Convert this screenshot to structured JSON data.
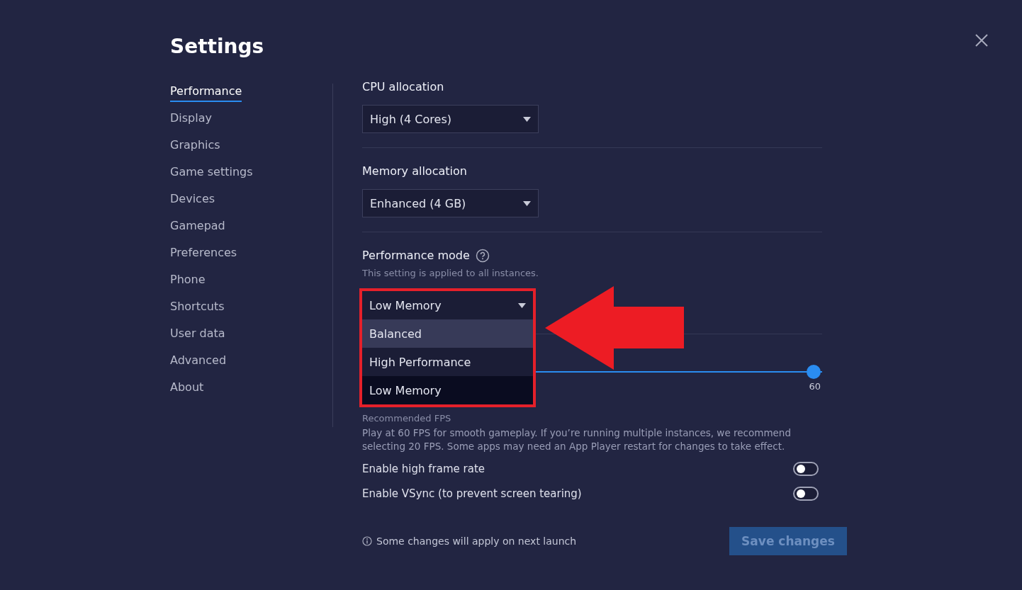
{
  "title": "Settings",
  "sidebar": {
    "items": [
      {
        "label": "Performance",
        "selected": true
      },
      {
        "label": "Display",
        "selected": false
      },
      {
        "label": "Graphics",
        "selected": false
      },
      {
        "label": "Game settings",
        "selected": false
      },
      {
        "label": "Devices",
        "selected": false
      },
      {
        "label": "Gamepad",
        "selected": false
      },
      {
        "label": "Preferences",
        "selected": false
      },
      {
        "label": "Phone",
        "selected": false
      },
      {
        "label": "Shortcuts",
        "selected": false
      },
      {
        "label": "User data",
        "selected": false
      },
      {
        "label": "Advanced",
        "selected": false
      },
      {
        "label": "About",
        "selected": false
      }
    ]
  },
  "cpu": {
    "label": "CPU allocation",
    "value": "High (4 Cores)"
  },
  "memory": {
    "label": "Memory allocation",
    "value": "Enhanced (4 GB)"
  },
  "performance_mode": {
    "label": "Performance mode",
    "hint": "This setting is applied to all instances.",
    "value": "Low Memory",
    "expanded": true,
    "options": [
      {
        "label": "Balanced",
        "highlighted": true,
        "selected": false
      },
      {
        "label": "High Performance",
        "highlighted": false,
        "selected": false
      },
      {
        "label": "Low Memory",
        "highlighted": false,
        "selected": true
      }
    ]
  },
  "fps": {
    "level": 1,
    "reading": "60",
    "caption": "Recommended FPS",
    "description": "Play at 60 FPS for smooth gameplay. If you’re running multiple instances, we recommend selecting 20 FPS. Some apps may need an App Player restart for changes to take effect."
  },
  "toggles": [
    {
      "label": "Enable high frame rate",
      "on": false
    },
    {
      "label": "Enable VSync (to prevent screen tearing)",
      "on": false
    }
  ],
  "footer_note": "Some changes will apply on next launch",
  "save_button": {
    "label": "Save changes",
    "disabled": true
  }
}
